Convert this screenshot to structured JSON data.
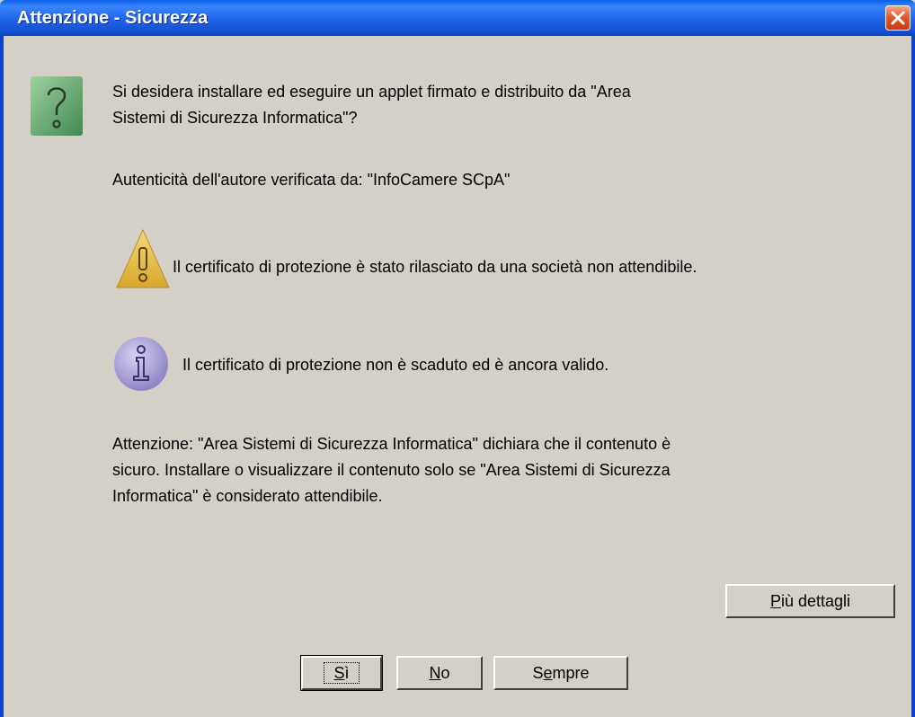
{
  "window": {
    "title": "Attenzione - Sicurezza"
  },
  "message": {
    "question_line1": "Si desidera installare ed eseguire un applet firmato e distribuito da \"Area",
    "question_line2": "Sistemi di Sicurezza Informatica\"?",
    "authenticity": "Autenticità dell'autore verificata da: \"InfoCamere SCpA\"",
    "warning": "Il certificato di protezione è stato rilasciato da una società non attendibile.",
    "info": "Il certificato di protezione non è scaduto ed è ancora valido.",
    "caution_line1": "Attenzione: \"Area Sistemi di Sicurezza Informatica\" dichiara che il contenuto è",
    "caution_line2": "sicuro. Installare o visualizzare il contenuto solo se \"Area Sistemi di Sicurezza",
    "caution_line3": "Informatica\" è considerato attendibile."
  },
  "buttons": {
    "details": {
      "mnemonic": "P",
      "rest": "iù dettagli"
    },
    "yes": {
      "mnemonic": "S",
      "rest": "ì"
    },
    "no": {
      "mnemonic": "N",
      "rest": "o"
    },
    "always": {
      "pre": "S",
      "mnemonic": "e",
      "rest": "mpre"
    }
  },
  "icons": {
    "question": "question-icon",
    "warning": "warning-icon",
    "info": "info-icon",
    "close": "close-icon"
  },
  "colors": {
    "titlebar": "#2367ea",
    "dialog_bg": "#d4d0c8",
    "question_icon": "#5fa66b",
    "warning_icon": "#e8c04a",
    "info_icon": "#9b8fd0",
    "close_button": "#e2582c"
  }
}
